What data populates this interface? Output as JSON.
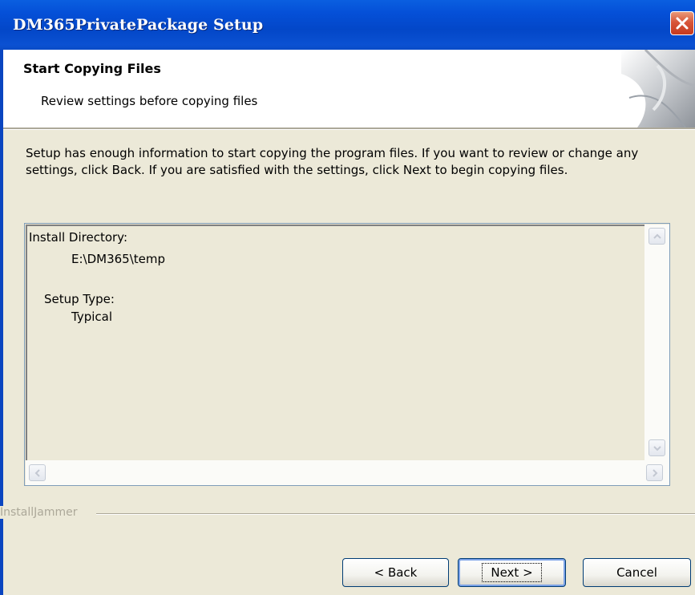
{
  "window": {
    "title": "DM365PrivatePackage Setup",
    "close_icon": "close-icon"
  },
  "header": {
    "title": "Start Copying Files",
    "subtitle": "Review settings before copying files"
  },
  "description": "Setup has enough information to start copying the program files.  If  you want to review or change any settings, click Back.  If you are  satisfied with the settings, click Next to begin copying files.",
  "review": {
    "install_dir_label": "Install Directory:",
    "install_dir_value": "E:\\DM365\\temp",
    "setup_type_label": "Setup Type:",
    "setup_type_value": "Typical"
  },
  "brand": "InstallJammer",
  "buttons": {
    "back": "< Back",
    "next": "Next >",
    "cancel": "Cancel"
  },
  "colors": {
    "titlebar": "#0550d8",
    "dialog_bg": "#ece9d8",
    "header_bg": "#ffffff",
    "close_button": "#d8563a"
  }
}
